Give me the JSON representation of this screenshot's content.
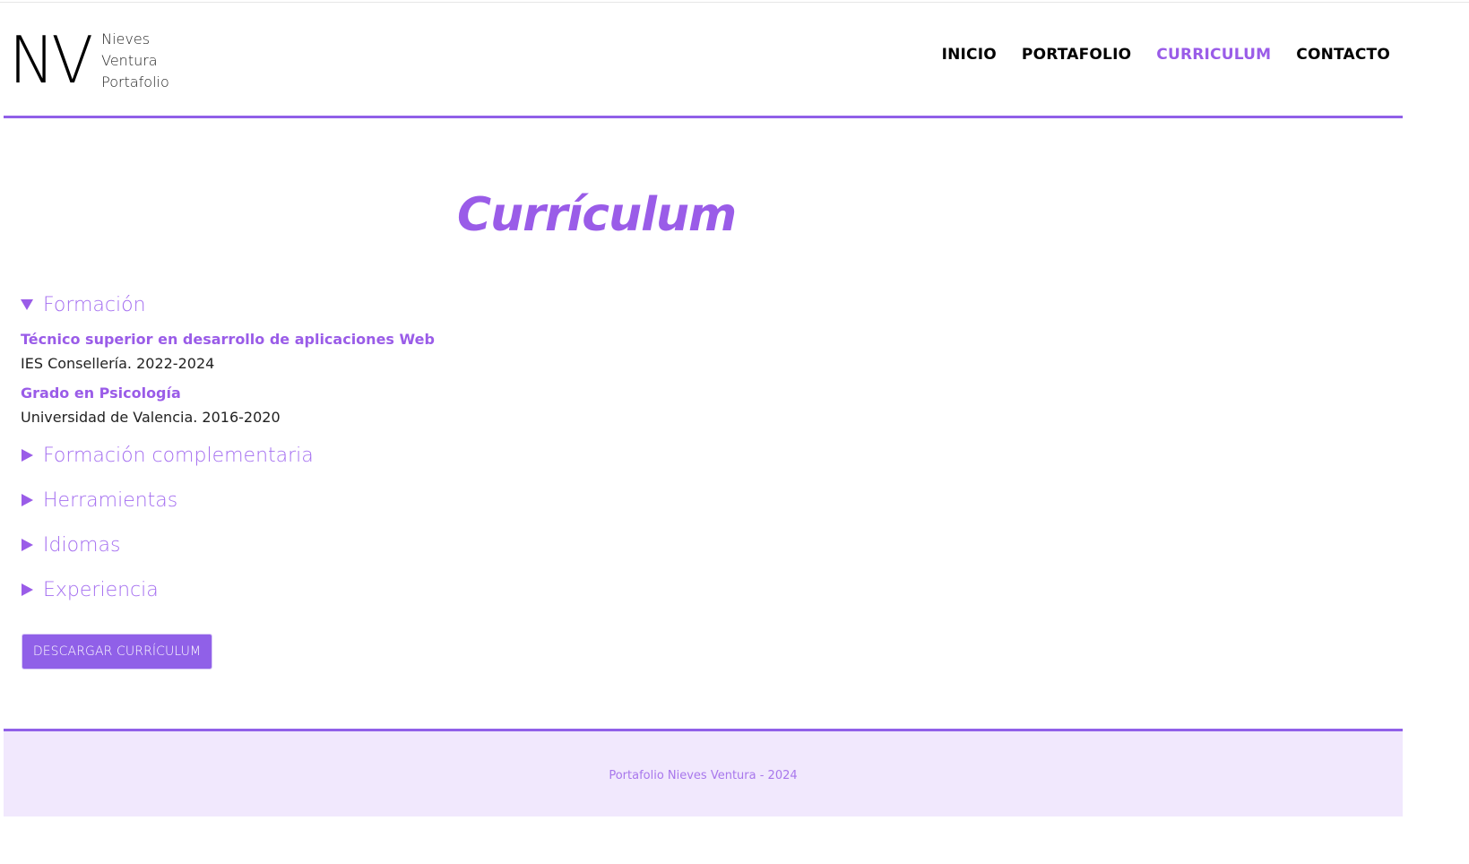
{
  "brand": {
    "mark": "NV",
    "lines": [
      "Nieves",
      "Ventura",
      "Portafolio"
    ]
  },
  "nav": {
    "items": [
      {
        "label": "INICIO",
        "active": false
      },
      {
        "label": "PORTAFOLIO",
        "active": false
      },
      {
        "label": "CURRICULUM",
        "active": true
      },
      {
        "label": "CONTACTO",
        "active": false
      }
    ]
  },
  "page": {
    "title": "Currículum"
  },
  "sections": [
    {
      "label": "Formación",
      "expanded": true,
      "entries": [
        {
          "title": "Técnico superior en desarrollo de aplicaciones Web",
          "detail": "IES Consellería. 2022-2024"
        },
        {
          "title": "Grado en Psicología",
          "detail": "Universidad de Valencia. 2016-2020"
        }
      ]
    },
    {
      "label": "Formación complementaria",
      "expanded": false
    },
    {
      "label": "Herramientas",
      "expanded": false
    },
    {
      "label": "Idiomas",
      "expanded": false
    },
    {
      "label": "Experiencia",
      "expanded": false
    }
  ],
  "download_button": {
    "label": "DESCARGAR CURRÍCULUM"
  },
  "footer": {
    "text": "Portafolio Nieves Ventura - 2024"
  },
  "colors": {
    "accent": "#9a5ce8",
    "footer_bg": "#f1e8fd"
  },
  "icons": {
    "expanded": "triangle-down-icon",
    "collapsed": "triangle-right-icon"
  }
}
